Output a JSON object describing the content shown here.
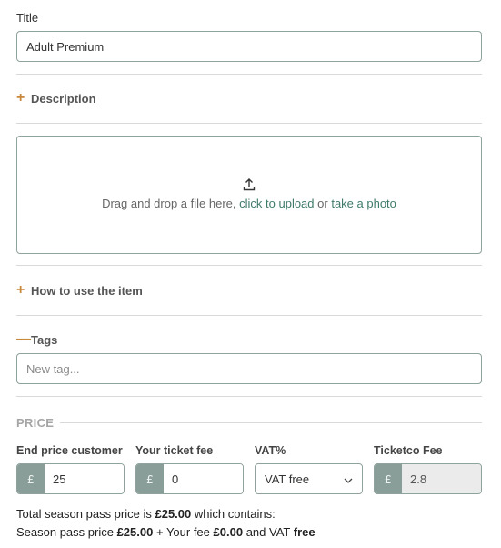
{
  "title_field": {
    "label": "Title",
    "value": "Adult Premium"
  },
  "description": {
    "label": "Description",
    "icon": "plus-icon"
  },
  "upload": {
    "text": "Drag and drop a file here,",
    "click_link": "click to upload",
    "or": "or",
    "photo_link": "take a photo",
    "icon": "upload-icon"
  },
  "how_to_use": {
    "label": "How to use the item",
    "icon": "plus-icon"
  },
  "tags": {
    "label": "Tags",
    "icon": "minus-icon",
    "placeholder": "New tag..."
  },
  "price": {
    "heading": "PRICE",
    "end_price": {
      "label": "End price customer",
      "currency": "£",
      "value": "25"
    },
    "ticket_fee": {
      "label": "Your ticket fee",
      "currency": "£",
      "value": "0"
    },
    "vat": {
      "label": "VAT%",
      "selected": "VAT free"
    },
    "ticketco_fee": {
      "label": "Ticketco Fee",
      "currency": "£",
      "value": "2.8"
    }
  },
  "summary": {
    "line1_prefix": "Total season pass price is",
    "line1_amount": "£25.00",
    "line1_suffix": "which contains:",
    "line2_prefix": "Season pass price",
    "line2_amount": "£25.00",
    "line2_mid1": "+ Your fee",
    "line2_fee": "£0.00",
    "line2_mid2": "and VAT",
    "line2_vat": "free"
  },
  "colors": {
    "accent": "#c8893c",
    "link": "#3f7a6a",
    "addon": "#8a9e99",
    "border": "#8fa29d"
  }
}
